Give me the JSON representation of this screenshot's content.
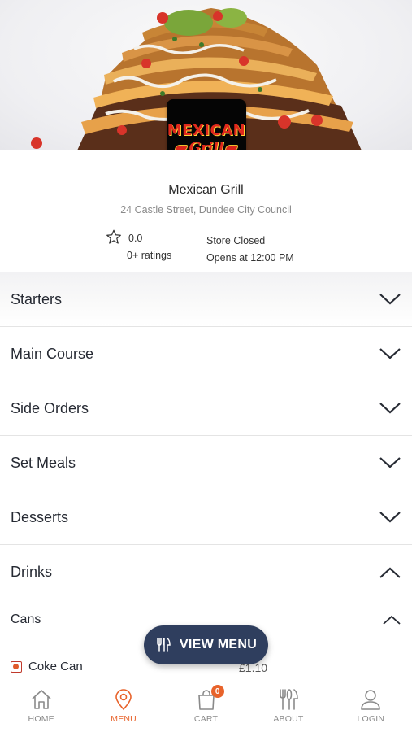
{
  "store": {
    "name": "Mexican Grill",
    "address": "24 Castle Street, Dundee City Council",
    "rating": "0.0",
    "rating_count": "0+ ratings",
    "status": "Store Closed",
    "opening": "Opens at 12:00 PM",
    "logo_text_top": "MEXICAN",
    "logo_text_bottom": "Grill"
  },
  "categories": [
    {
      "label": "Starters",
      "expanded": false
    },
    {
      "label": "Main Course",
      "expanded": false
    },
    {
      "label": "Side Orders",
      "expanded": false
    },
    {
      "label": "Set Meals",
      "expanded": false
    },
    {
      "label": "Desserts",
      "expanded": false
    },
    {
      "label": "Drinks",
      "expanded": true
    }
  ],
  "subcategory": {
    "label": "Cans",
    "expanded": true
  },
  "items": [
    {
      "name": "Coke Can",
      "price": "£1.10",
      "selected": true
    }
  ],
  "floating_button": {
    "label": "VIEW MENU",
    "icon": "cutlery-icon"
  },
  "bottom_nav": [
    {
      "label": "HOME",
      "icon": "home-icon",
      "active": false
    },
    {
      "label": "MENU",
      "icon": "location-pin-icon",
      "active": true
    },
    {
      "label": "CART",
      "icon": "shopping-bag-icon",
      "active": false,
      "badge": "0"
    },
    {
      "label": "ABOUT",
      "icon": "cutlery-icon",
      "active": false
    },
    {
      "label": "LOGIN",
      "icon": "user-icon",
      "active": false
    }
  ],
  "colors": {
    "accent": "#e8632b",
    "button_bg": "#2f3e5e",
    "text_dark": "#262a33",
    "text_muted": "#8a8a8a"
  }
}
